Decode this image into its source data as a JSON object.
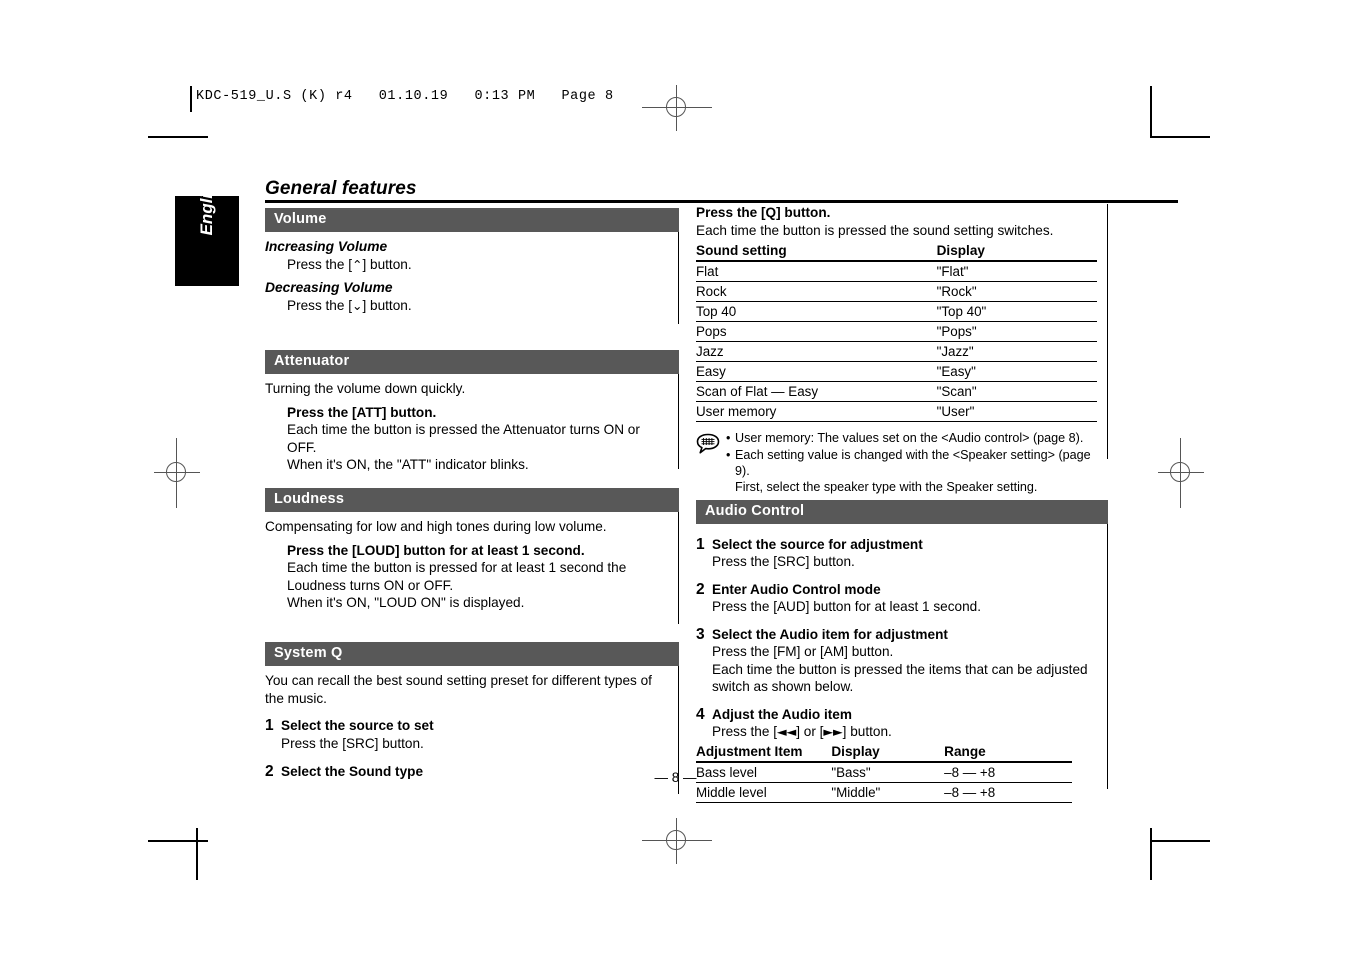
{
  "print_marks": {
    "file_header": "KDC-519_U.S (K) r4   01.10.19   0:13 PM   Page 8"
  },
  "sidebar": {
    "language_tab": "English"
  },
  "header": {
    "title": "General features"
  },
  "footer": {
    "page_number": "— 8 —"
  },
  "left_column": {
    "volume": {
      "heading": "Volume",
      "increasing_label": "Increasing Volume",
      "increasing_action_prefix": "Press the [",
      "increasing_glyph": "⌃",
      "increasing_action_suffix": "] button.",
      "decreasing_label": "Decreasing Volume",
      "decreasing_action_prefix": "Press the [",
      "decreasing_glyph": "⌄",
      "decreasing_action_suffix": "] button."
    },
    "attenuator": {
      "heading": "Attenuator",
      "intro": "Turning the volume down quickly.",
      "action": "Press the [ATT] button.",
      "detail_1": "Each time the button is pressed the Attenuator turns ON or OFF.",
      "detail_2": "When it's ON, the \"ATT\" indicator blinks."
    },
    "loudness": {
      "heading": "Loudness",
      "intro": "Compensating for low and high tones during low volume.",
      "action": "Press the [LOUD] button for at least 1 second.",
      "detail_1": "Each time the button is pressed for at least 1 second the",
      "detail_2": "Loudness turns ON or OFF.",
      "detail_3": "When it's ON, \"LOUD ON\" is displayed."
    },
    "system_q": {
      "heading": "System Q",
      "intro_line_1": "You can recall the best sound setting preset for different types of",
      "intro_line_2": "the music.",
      "steps": [
        {
          "num": "1",
          "title": "Select the source to set",
          "sub": "Press the [SRC] button."
        },
        {
          "num": "2",
          "title": "Select the Sound type",
          "sub": ""
        }
      ]
    }
  },
  "right_column": {
    "system_q_continued": {
      "action": "Press the [Q] button.",
      "detail": "Each time the button is pressed the sound setting switches.",
      "table": {
        "headers": [
          "Sound setting",
          "Display"
        ],
        "rows": [
          [
            "Flat",
            "\"Flat\""
          ],
          [
            "Rock",
            "\"Rock\""
          ],
          [
            "Top 40",
            "\"Top 40\""
          ],
          [
            "Pops",
            "\"Pops\""
          ],
          [
            "Jazz",
            "\"Jazz\""
          ],
          [
            "Easy",
            "\"Easy\""
          ],
          [
            "Scan of Flat — Easy",
            "\"Scan\""
          ],
          [
            "User memory",
            "\"User\""
          ]
        ]
      },
      "note": {
        "icon": "note-bubble-icon",
        "bullets": [
          "User memory: The values set on the <Audio control> (page 8).",
          "Each setting value is changed with the <Speaker setting> (page 9)."
        ],
        "trailing": "First, select the speaker type with the Speaker setting."
      }
    },
    "audio_control": {
      "heading": "Audio Control",
      "steps": [
        {
          "num": "1",
          "title": "Select the source for adjustment",
          "sub_1": "Press the [SRC] button.",
          "sub_2": ""
        },
        {
          "num": "2",
          "title": "Enter Audio Control mode",
          "sub_1": "Press the [AUD] button for at least 1 second.",
          "sub_2": ""
        },
        {
          "num": "3",
          "title": "Select the Audio item for adjustment",
          "sub_1": "Press the [FM] or [AM] button.",
          "sub_2": "Each time the button is pressed the items that can be adjusted",
          "sub_3": "switch as shown below."
        }
      ],
      "step_4": {
        "num": "4",
        "title": "Adjust the Audio item",
        "sub_prefix": "Press the [",
        "sub_glyph_back": "◄◄",
        "sub_middle": "] or [",
        "sub_glyph_fwd": "►►",
        "sub_suffix": "] button."
      },
      "table": {
        "headers": [
          "Adjustment Item",
          "Display",
          "Range"
        ],
        "rows": [
          [
            "Bass level",
            "\"Bass\"",
            "–8 — +8"
          ],
          [
            "Middle level",
            "\"Middle\"",
            "–8 — +8"
          ]
        ]
      }
    }
  },
  "colors": {
    "section_bar": "#585858",
    "text": "#000000",
    "page_background": "#ffffff"
  }
}
